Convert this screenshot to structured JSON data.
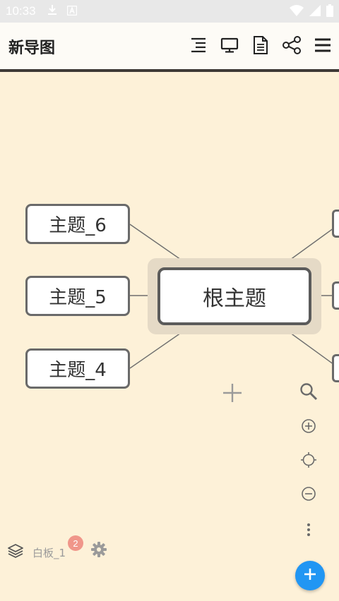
{
  "status_bar": {
    "time": "10:33"
  },
  "toolbar": {
    "title": "新导图"
  },
  "canvas": {
    "root_topic": "根主题",
    "topics": [
      {
        "label": "主题_6"
      },
      {
        "label": "主题_5"
      },
      {
        "label": "主题_4"
      }
    ]
  },
  "bottom_bar": {
    "board_name": "白板_1",
    "badge_count": "2"
  },
  "colors": {
    "canvas_bg": "#fdf1d8",
    "fab": "#2196f3",
    "badge": "#f0968a",
    "node_border": "#6a6a6a"
  },
  "icons": [
    "download-icon",
    "font-icon",
    "wifi-icon",
    "signal-icon",
    "battery-icon",
    "outline-icon",
    "present-icon",
    "document-icon",
    "share-icon",
    "menu-icon",
    "add-icon",
    "search-icon",
    "zoom-in-icon",
    "locate-icon",
    "zoom-out-icon",
    "more-icon",
    "layers-icon",
    "gear-icon",
    "plus-icon"
  ]
}
